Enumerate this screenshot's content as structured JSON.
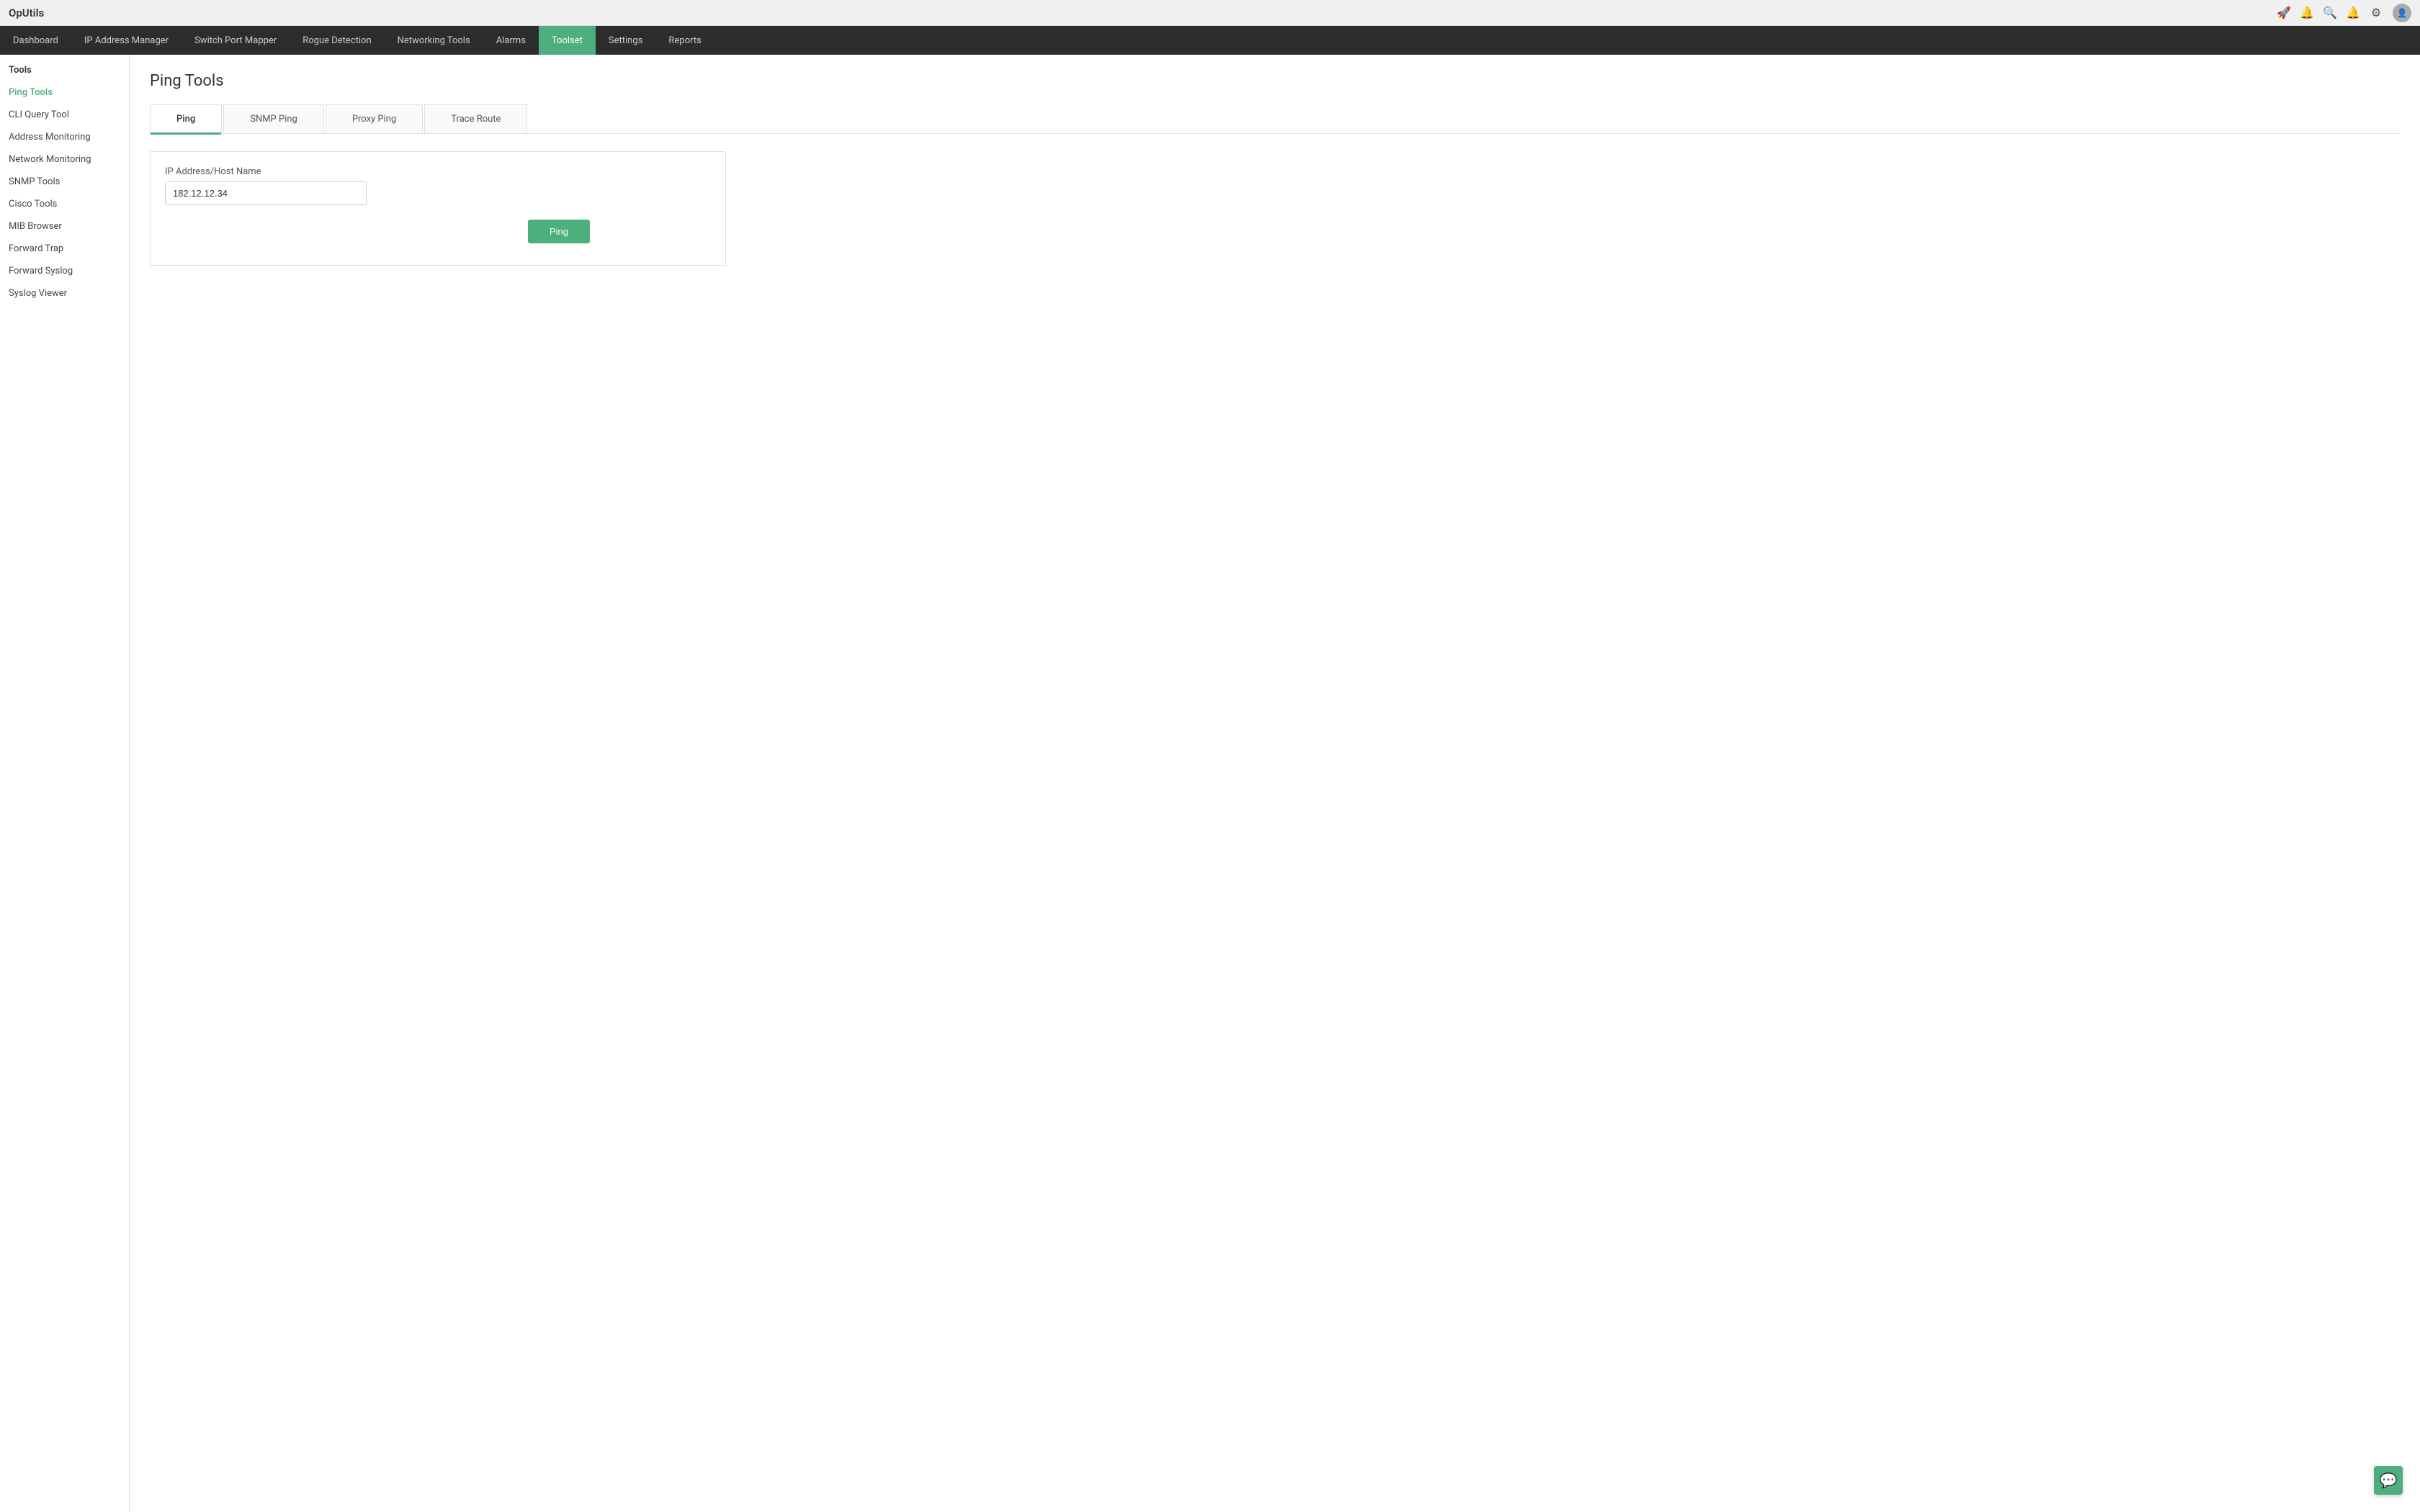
{
  "app": {
    "logo": "OpUtils"
  },
  "topbar": {
    "icons": [
      {
        "name": "rocket-icon",
        "symbol": "🚀"
      },
      {
        "name": "bell-outline-icon",
        "symbol": "🔔"
      },
      {
        "name": "search-icon",
        "symbol": "🔍"
      },
      {
        "name": "notification-icon",
        "symbol": "🔔"
      },
      {
        "name": "settings-icon",
        "symbol": "⚙"
      }
    ]
  },
  "nav": {
    "items": [
      {
        "label": "Dashboard",
        "active": false
      },
      {
        "label": "IP Address Manager",
        "active": false
      },
      {
        "label": "Switch Port Mapper",
        "active": false
      },
      {
        "label": "Rogue Detection",
        "active": false
      },
      {
        "label": "Networking Tools",
        "active": false
      },
      {
        "label": "Alarms",
        "active": false
      },
      {
        "label": "Toolset",
        "active": true
      },
      {
        "label": "Settings",
        "active": false
      },
      {
        "label": "Reports",
        "active": false
      }
    ]
  },
  "sidebar": {
    "section_title": "Tools",
    "items": [
      {
        "label": "Ping Tools",
        "active": true
      },
      {
        "label": "CLI Query Tool",
        "active": false
      },
      {
        "label": "Address Monitoring",
        "active": false
      },
      {
        "label": "Network Monitoring",
        "active": false
      },
      {
        "label": "SNMP Tools",
        "active": false
      },
      {
        "label": "Cisco Tools",
        "active": false
      },
      {
        "label": "MIB Browser",
        "active": false
      },
      {
        "label": "Forward Trap",
        "active": false
      },
      {
        "label": "Forward Syslog",
        "active": false
      },
      {
        "label": "Syslog Viewer",
        "active": false
      }
    ]
  },
  "main": {
    "page_title": "Ping Tools",
    "tabs": [
      {
        "label": "Ping",
        "active": true
      },
      {
        "label": "SNMP Ping",
        "active": false
      },
      {
        "label": "Proxy Ping",
        "active": false
      },
      {
        "label": "Trace Route",
        "active": false
      }
    ],
    "form": {
      "ip_label": "IP Address/Host Name",
      "ip_value": "182.12.12.34",
      "ip_placeholder": ""
    },
    "ping_button": "Ping"
  },
  "chat_button": {
    "symbol": "💬"
  }
}
